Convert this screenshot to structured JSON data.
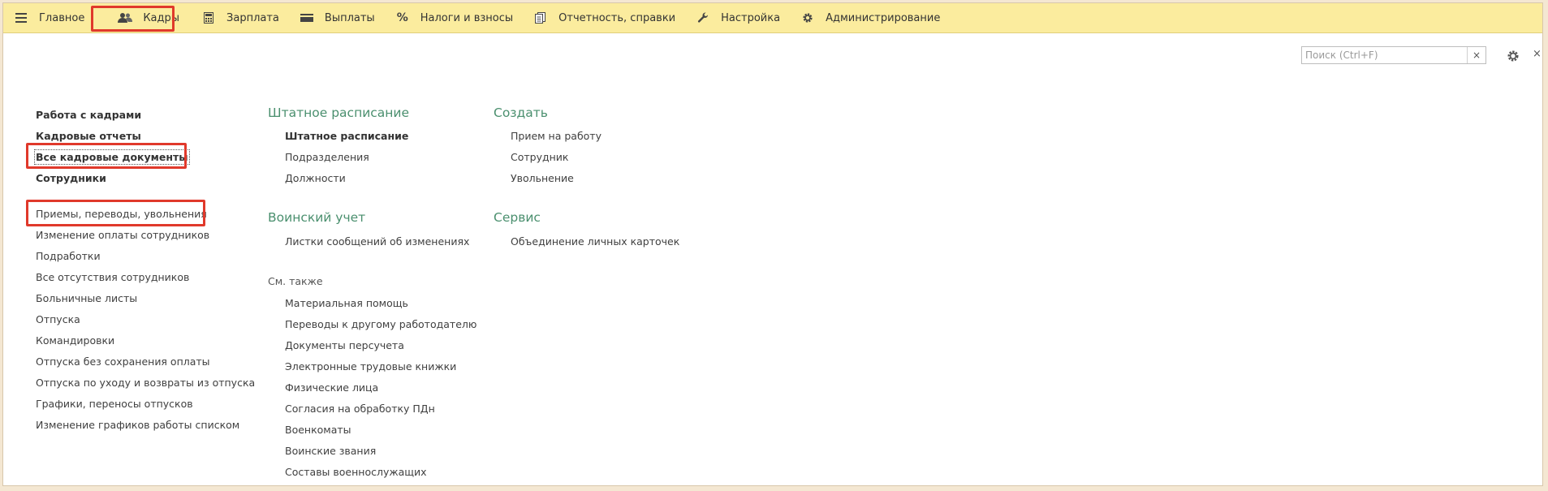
{
  "menu": {
    "items": [
      {
        "label": "Главное",
        "icon": "menu-burger-icon"
      },
      {
        "label": "Кадры",
        "icon": "people-icon"
      },
      {
        "label": "Зарплата",
        "icon": "calculator-icon"
      },
      {
        "label": "Выплаты",
        "icon": "wallet-icon"
      },
      {
        "label": "Налоги и взносы",
        "icon": "percent-icon"
      },
      {
        "label": "Отчетность, справки",
        "icon": "documents-icon"
      },
      {
        "label": "Настройка",
        "icon": "wrench-icon"
      },
      {
        "label": "Администрирование",
        "icon": "gear-icon"
      }
    ]
  },
  "search": {
    "placeholder": "Поиск (Ctrl+F)",
    "clear": "×"
  },
  "close_label": "×",
  "left_column": {
    "bold_items": [
      "Работа с кадрами",
      "Кадровые отчеты",
      "Все кадровые документы",
      "Сотрудники"
    ],
    "items": [
      "Приемы, переводы, увольнения",
      "Изменение оплаты сотрудников",
      "Подработки",
      "Все отсутствия сотрудников",
      "Больничные листы",
      "Отпуска",
      "Командировки",
      "Отпуска без сохранения оплаты",
      "Отпуска по уходу и возвраты из отпуска",
      "Графики, переносы отпусков",
      "Изменение графиков работы списком"
    ]
  },
  "middle_column": {
    "staffing": {
      "title": "Штатное расписание",
      "items": [
        "Штатное расписание",
        "Подразделения",
        "Должности"
      ]
    },
    "military": {
      "title": "Воинский учет",
      "items": [
        "Листки сообщений об изменениях"
      ]
    },
    "see_also": {
      "title": "См. также",
      "items": [
        "Материальная помощь",
        "Переводы к другому работодателю",
        "Документы персучета",
        "Электронные трудовые книжки",
        "Физические лица",
        "Согласия на обработку ПДн",
        "Военкоматы",
        "Воинские звания",
        "Составы военнослужащих"
      ]
    }
  },
  "right_column": {
    "create": {
      "title": "Создать",
      "items": [
        "Прием на работу",
        "Сотрудник",
        "Увольнение"
      ]
    },
    "service": {
      "title": "Сервис",
      "items": [
        "Объединение личных карточек"
      ]
    }
  },
  "colors": {
    "menubar": "#fbec9e",
    "accent_heading": "#4a8f6e",
    "highlight": "#e0392b"
  }
}
